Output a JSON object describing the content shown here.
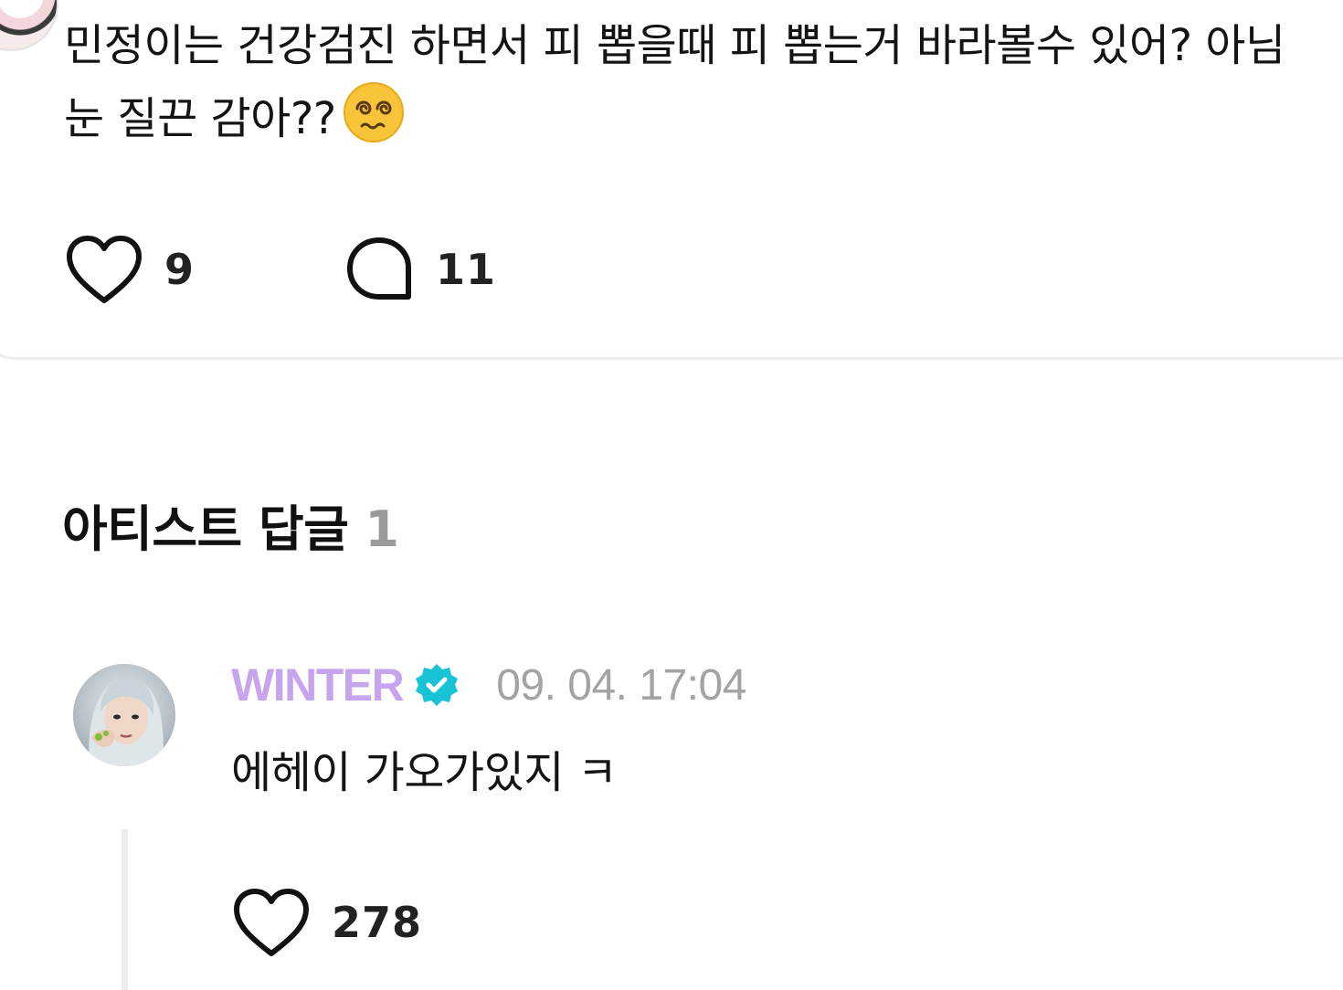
{
  "post": {
    "text": "민정이는 건강검진 하면서 피 뽑을때 피 뽑는거 바라볼수 있어? 아님 눈 질끈 감아??",
    "emoji": "face-with-spiral-eyes",
    "like_count": "9",
    "comment_count": "11"
  },
  "artist_replies": {
    "title": "아티스트 답글",
    "count": "1"
  },
  "reply": {
    "author": "WINTER",
    "timestamp": "09. 04. 17:04",
    "text": "에헤이 가오가있지 ㅋ",
    "like_count": "278"
  },
  "colors": {
    "author_name": "#c7a4ee",
    "verified_badge": "#19c3d6",
    "timestamp": "#a3a3a3",
    "section_count": "#9a9a9a",
    "divider": "#ececef"
  },
  "icons": {
    "like": "heart-outline-icon",
    "comment": "speech-bubble-icon",
    "verified": "verified-check-icon"
  }
}
